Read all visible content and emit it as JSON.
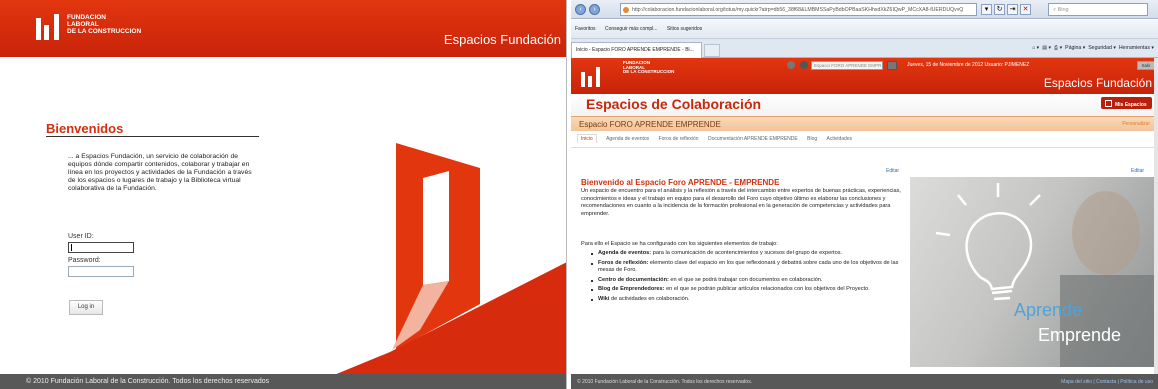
{
  "left": {
    "logo": {
      "line1": "FUNDACION",
      "line2": "LABORAL",
      "line3": "DE LA CONSTRUCCION"
    },
    "header_title": "Espacios Fundación",
    "welcome": "Bienvenidos",
    "intro": "... a Espacios Fundación, un servicio de colaboración de equipos dónde compartir contenidos, colaborar y trabajar en línea en los proyectos y actividades de la Fundación a través de los espacios o lugares de trabajo y la Biblioteca virtual colaborativa de la Fundación.",
    "userid_label": "User ID:",
    "userid_value": "",
    "password_label": "Password:",
    "password_value": "",
    "login_label": "Log in",
    "footer": "© 2010 Fundación Laboral de la Construcción. Todos los derechos reservados"
  },
  "right": {
    "browser": {
      "url": "http://colaboracion.fundacionlaboral.org/totus/my.quickr?atrp=db56_38f68&LMBMSSaPyBdbOPBaaSKHhxdXkZ6IQwP_MCcXA8-fUERDUQvvQ",
      "search_placeholder": "Bing",
      "fav_label": "Favoritos",
      "fav_item1": "Conseguir más compl...",
      "fav_item2": "Sitios sugeridos",
      "tab_label": "Inicio - Espacio FORO APRENDE EMPRENDE - Bl...",
      "commands": [
        "Página",
        "Seguridad",
        "Herramientas"
      ]
    },
    "header": {
      "logo": {
        "line1": "FUNDACION",
        "line2": "LABORAL",
        "line3": "DE LA CONSTRUCCION"
      },
      "search_value": "Espacio FORO APRENDE EMPR",
      "date_user": "Jueves, 15 de Noviembre de 2012  Usuario: PJIMENEZ",
      "salir": "Salir",
      "title": "Espacios Fundación"
    },
    "banner": {
      "title": "Espacios de Colaboración",
      "mis_espacios": "Mis Espacios"
    },
    "espacio": {
      "title": "Espacio FORO APRENDE EMPRENDE",
      "right_text": "Personalizar"
    },
    "subnav": [
      "Inicio",
      "Agenda de eventos",
      "Foros de reflexión",
      "Documentación APRENDE EMPRENDE",
      "Blog",
      "Actividades"
    ],
    "editar": "Editar",
    "content": {
      "title": "Bienvenido al Espacio Foro APRENDE - EMPRENDE",
      "para1": "Un espacio de encuentro para el análisis y la reflexión a través del intercambio entre expertos de buenas prácticas, experiencias, conocimientos e ideas y el trabajo en equipo para el desarrollo del Foro cuyo objetivo último es elaborar las conclusiones y recomendaciones en cuanto a la incidencia de la formación profesional en la generación de competencias y actividades para emprender.",
      "para2": "Para ello el Espacio se ha configurado con los siguientes elementos de trabajo:",
      "items": [
        {
          "b": "Agenda de eventos:",
          "t": " para la comunicación de acontencimientos y sucesos del grupo de expertos."
        },
        {
          "b": "Foros de reflexión:",
          "t": " elemento clave del espacio en los que reflexionará y debatirá sobre cada uno de los objetivos de las mesas de Foro."
        },
        {
          "b": "Centro de documentación:",
          "t": " en el que se podrá trabajar con documentos en colaboración."
        },
        {
          "b": "Blog de Emprendedores:",
          "t": " en el que se podrán publicar artículos relacionados con los objetivos del Proyecto."
        },
        {
          "b": "Wiki",
          "t": " de actividades en colaboración."
        }
      ]
    },
    "photo": {
      "word1": "Aprende",
      "word2": "Emprende"
    },
    "footer": "© 2010 Fundación Laboral de la Construcción. Todos los derechos reservados.",
    "footer_links": "Mapa del sitio | Contacta | Política de uso"
  },
  "colors": {
    "brand_red": "#d2300f",
    "footer_gray": "#585858",
    "espacio_orange": "#f4c397"
  }
}
